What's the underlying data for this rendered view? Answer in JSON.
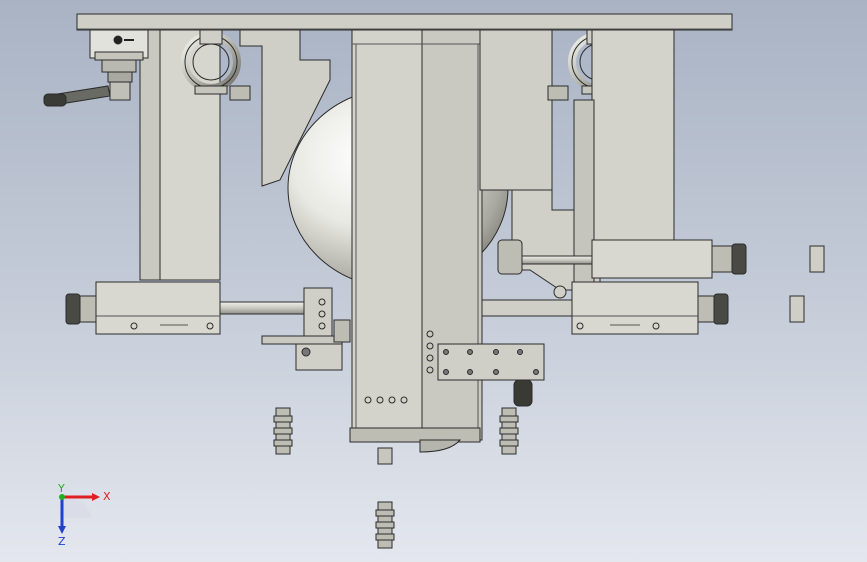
{
  "viewport": {
    "background_top": "#a9b3c4",
    "background_bottom": "#e4e7ee",
    "part_fill": "#d6d6cf",
    "part_fill_dark": "#bdbdb4",
    "part_edge": "#2b2b2b",
    "sphere_highlight": "#ffffff",
    "sphere_shadow": "#8c8c85"
  },
  "triad": {
    "x_label": "X",
    "y_label": "Y",
    "z_label": "Z",
    "x_color": "#e02020",
    "y_color": "#20b020",
    "z_color": "#2040d0"
  },
  "icons": [
    "lifting-eye-bolt-icon",
    "handle-lever-icon",
    "coordinate-triad-icon"
  ]
}
